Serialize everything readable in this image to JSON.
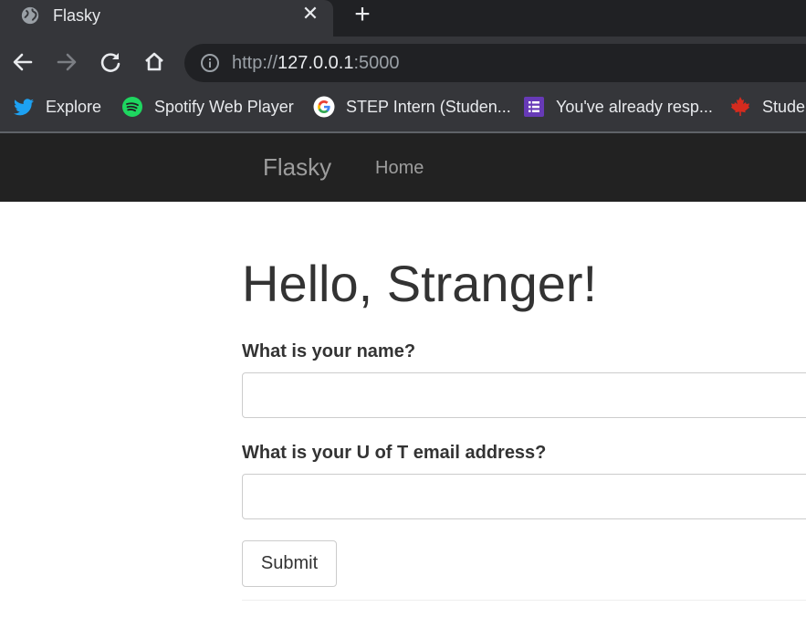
{
  "browser": {
    "tab": {
      "title": "Flasky",
      "close_glyph": "✕",
      "favicon": "globe-icon"
    },
    "new_tab_glyph": "+",
    "toolbar": {
      "url_scheme": "http://",
      "url_host": "127.0.0.1",
      "url_port": ":5000"
    },
    "bookmarks": [
      {
        "label": "Explore",
        "icon": "twitter-icon",
        "color": "#1da1f2"
      },
      {
        "label": "Spotify Web Player",
        "icon": "spotify-icon",
        "color": "#1ed760"
      },
      {
        "label": "STEP Intern (Studen...",
        "icon": "google-icon",
        "color": "#4285f4"
      },
      {
        "label": "You've already resp...",
        "icon": "google-forms-icon",
        "color": "#673ab7"
      },
      {
        "label": "Studer",
        "icon": "maple-leaf-icon",
        "color": "#d52b1e"
      }
    ]
  },
  "navbar": {
    "brand": "Flasky",
    "links": [
      {
        "label": "Home"
      }
    ]
  },
  "page": {
    "heading": "Hello, Stranger!",
    "form": {
      "name_label": "What is your name?",
      "name_value": "",
      "email_label": "What is your U of T email address?",
      "email_value": "",
      "submit_label": "Submit"
    }
  }
}
